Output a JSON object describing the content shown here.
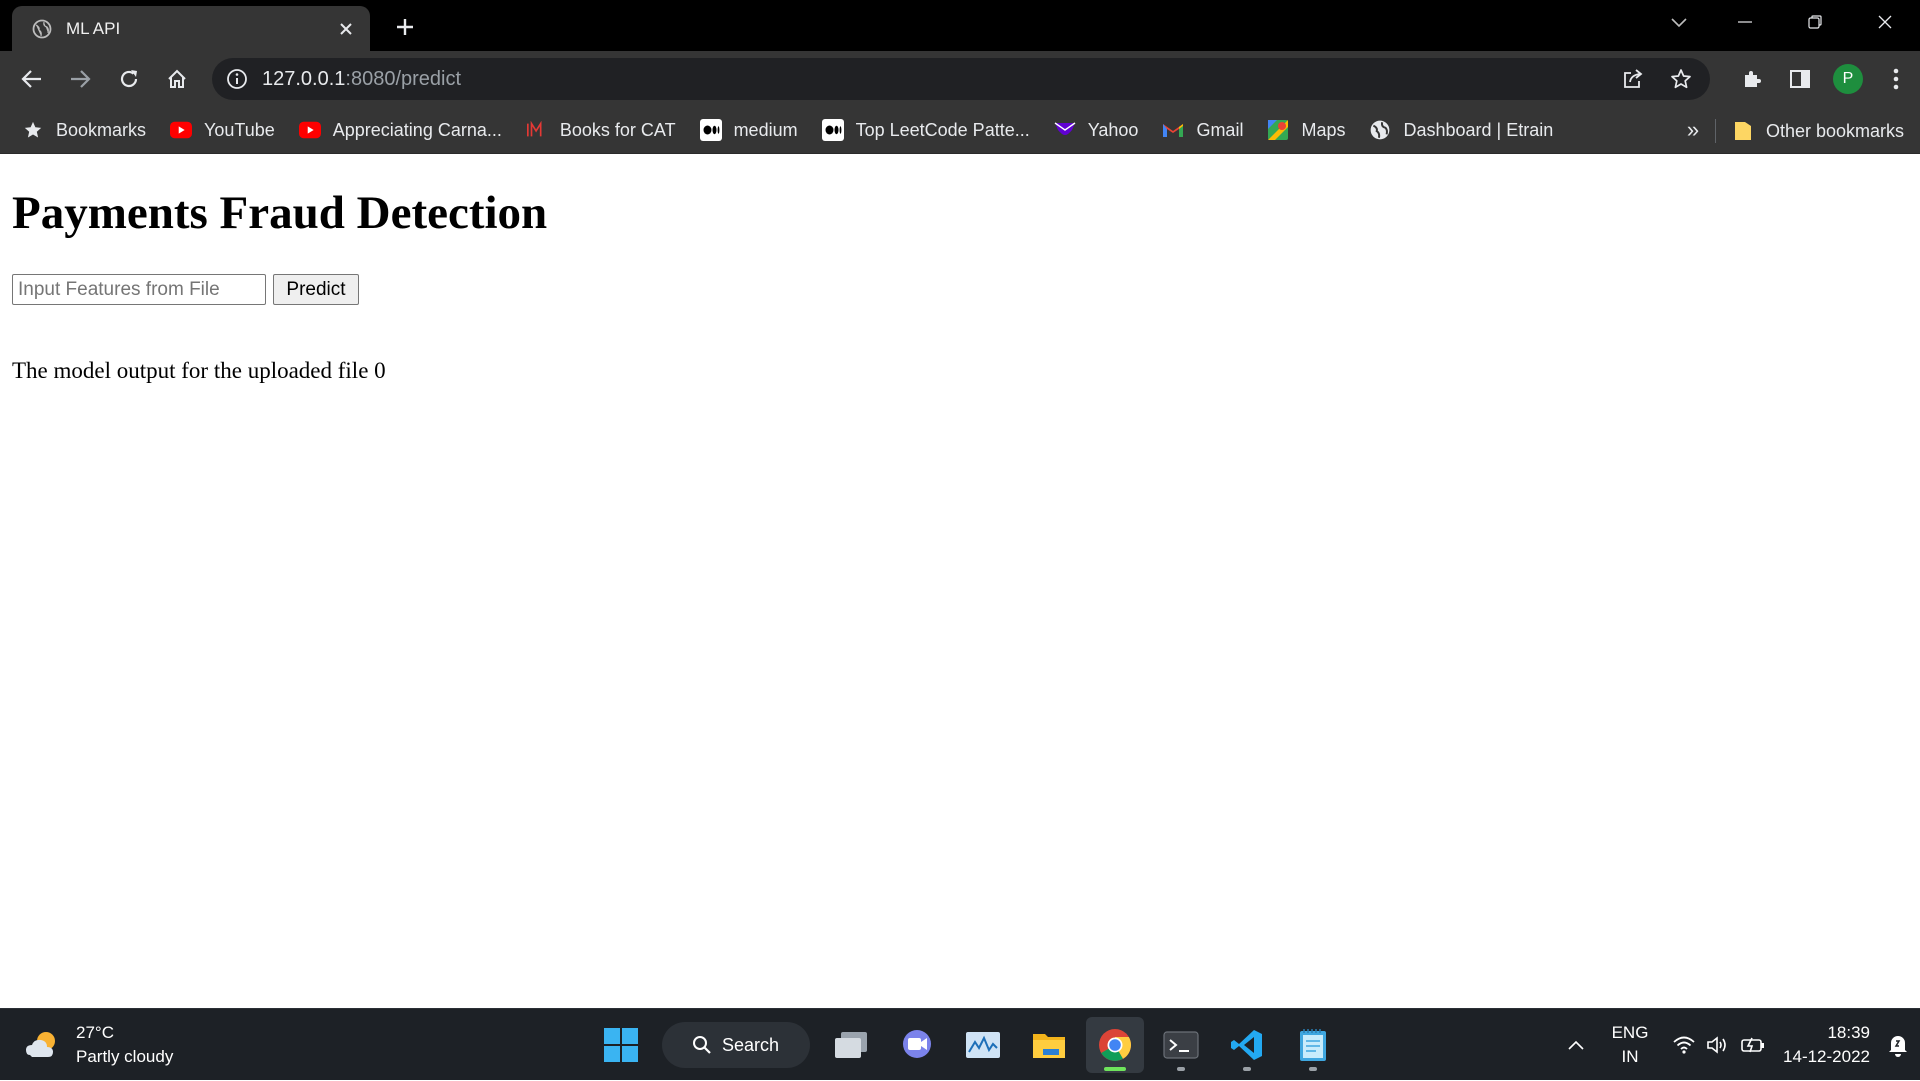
{
  "browser": {
    "tab": {
      "title": "ML API",
      "icon": "globe-icon"
    },
    "url": {
      "host": "127.0.0.1",
      "path": ":8080/predict"
    },
    "profile_initial": "P",
    "bookmarks": [
      {
        "label": "Bookmarks",
        "icon": "star-icon"
      },
      {
        "label": "YouTube",
        "icon": "youtube-icon"
      },
      {
        "label": "Appreciating Carna...",
        "icon": "youtube-icon"
      },
      {
        "label": "Books for CAT",
        "icon": "im-logo-icon"
      },
      {
        "label": "medium",
        "icon": "medium-icon"
      },
      {
        "label": "Top LeetCode Patte...",
        "icon": "medium-icon"
      },
      {
        "label": "Yahoo",
        "icon": "yahoo-icon"
      },
      {
        "label": "Gmail",
        "icon": "gmail-icon"
      },
      {
        "label": "Maps",
        "icon": "maps-icon"
      },
      {
        "label": "Dashboard | Etrain",
        "icon": "globe-icon"
      }
    ],
    "bookmarks_more": "»",
    "other_bookmarks": "Other bookmarks"
  },
  "page": {
    "heading": "Payments Fraud Detection",
    "file_input_placeholder": "Input Features from File",
    "predict_label": "Predict",
    "output_text": "The model output for the uploaded file 0"
  },
  "taskbar": {
    "weather_temp": "27°C",
    "weather_desc": "Partly cloudy",
    "search_label": "Search",
    "lang_line1": "ENG",
    "lang_line2": "IN",
    "time": "18:39",
    "date": "14-12-2022"
  },
  "colors": {
    "tab_bg": "#353535",
    "titlebar": "#000000",
    "omnibox": "#202124",
    "taskbar": "#1d2126",
    "active_indicator": "#6fe35c"
  }
}
